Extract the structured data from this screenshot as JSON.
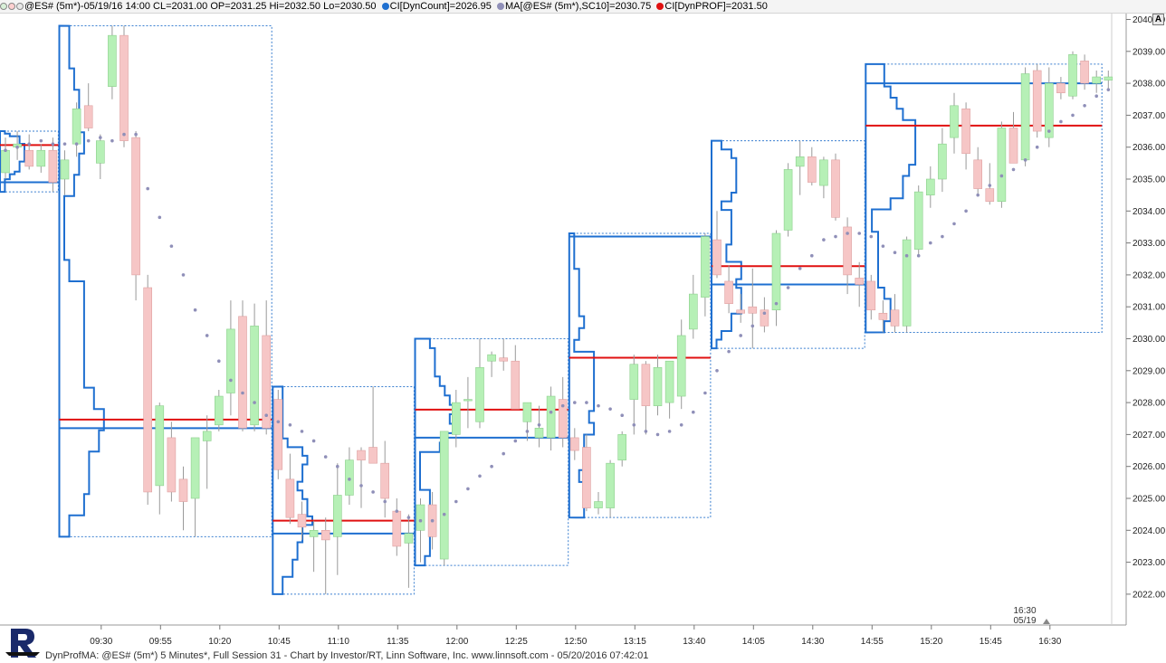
{
  "legend": {
    "symbol_info": "@ES# (5m*)-05/19/16 14:00 CL=2031.00 OP=2031.25 Hi=2032.50 Lo=2030.50",
    "dyncount": "CI[DynCount]=2026.95",
    "ma": "MA[@ES# (5m*),SC10]=2030.75",
    "dynprof": "CI[DynPROF]=2031.50",
    "colors": {
      "dyncount": "#1e6fd0",
      "ma": "#8f8fb8",
      "dynprof": "#e01010"
    }
  },
  "corner_button": "A",
  "footer": "DynProfMA: @ES# (5m*) 5 Minutes*, Full Session 31 - Chart by Investor/RT, Linn Software, Inc. www.linnsoft.com - 05/20/2016 07:42:01",
  "chart_data": {
    "type": "candlestick",
    "y_ticks": [
      2022,
      2023,
      2024,
      2025,
      2026,
      2027,
      2028,
      2029,
      2030,
      2031,
      2032,
      2033,
      2034,
      2035,
      2036,
      2037,
      2038,
      2039,
      2040
    ],
    "ylim": [
      2021.5,
      2040.3
    ],
    "time_ticks": [
      {
        "label": "09:30",
        "i": 8
      },
      {
        "label": "09:55",
        "i": 13
      },
      {
        "label": "10:20",
        "i": 18
      },
      {
        "label": "10:45",
        "i": 23
      },
      {
        "label": "11:10",
        "i": 28
      },
      {
        "label": "11:35",
        "i": 33
      },
      {
        "label": "12:00",
        "i": 38
      },
      {
        "label": "12:25",
        "i": 43
      },
      {
        "label": "12:50",
        "i": 48
      },
      {
        "label": "13:15",
        "i": 53
      },
      {
        "label": "13:40",
        "i": 58
      },
      {
        "label": "14:05",
        "i": 63
      },
      {
        "label": "14:30",
        "i": 68
      },
      {
        "label": "14:55",
        "i": 73
      },
      {
        "label": "15:20",
        "i": 78
      },
      {
        "label": "15:45",
        "i": 83
      },
      {
        "label": "16:30",
        "i": 88
      }
    ],
    "last_label": {
      "time": "16:30",
      "date": "05/19"
    },
    "candles": [
      {
        "o": 2035.2,
        "h": 2036.3,
        "l": 2035.0,
        "c": 2035.9
      },
      {
        "o": 2036.0,
        "h": 2036.5,
        "l": 2035.6,
        "c": 2036.1
      },
      {
        "o": 2035.9,
        "h": 2036.4,
        "l": 2035.3,
        "c": 2035.4
      },
      {
        "o": 2035.4,
        "h": 2036.1,
        "l": 2035.2,
        "c": 2035.9
      },
      {
        "o": 2035.9,
        "h": 2036.3,
        "l": 2034.6,
        "c": 2034.9
      },
      {
        "o": 2035.0,
        "h": 2035.9,
        "l": 2034.5,
        "c": 2035.6
      },
      {
        "o": 2036.1,
        "h": 2037.4,
        "l": 2035.7,
        "c": 2037.2
      },
      {
        "o": 2037.3,
        "h": 2038.0,
        "l": 2036.5,
        "c": 2036.6
      },
      {
        "o": 2035.5,
        "h": 2036.4,
        "l": 2035.0,
        "c": 2036.2
      },
      {
        "o": 2037.9,
        "h": 2039.8,
        "l": 2037.5,
        "c": 2039.5
      },
      {
        "o": 2039.5,
        "h": 2039.8,
        "l": 2036.0,
        "c": 2036.2
      },
      {
        "o": 2036.3,
        "h": 2036.5,
        "l": 2031.2,
        "c": 2032.0
      },
      {
        "o": 2031.6,
        "h": 2032.0,
        "l": 2024.8,
        "c": 2025.2
      },
      {
        "o": 2025.4,
        "h": 2028.0,
        "l": 2024.5,
        "c": 2027.9
      },
      {
        "o": 2026.9,
        "h": 2027.4,
        "l": 2024.9,
        "c": 2025.2
      },
      {
        "o": 2025.6,
        "h": 2026.0,
        "l": 2024.0,
        "c": 2024.9
      },
      {
        "o": 2025.0,
        "h": 2026.0,
        "l": 2023.8,
        "c": 2026.9
      },
      {
        "o": 2026.8,
        "h": 2027.6,
        "l": 2025.3,
        "c": 2027.1
      },
      {
        "o": 2027.3,
        "h": 2028.4,
        "l": 2027.1,
        "c": 2028.2
      },
      {
        "o": 2028.3,
        "h": 2031.2,
        "l": 2027.6,
        "c": 2030.3
      },
      {
        "o": 2030.7,
        "h": 2031.2,
        "l": 2027.1,
        "c": 2027.2
      },
      {
        "o": 2027.3,
        "h": 2031.1,
        "l": 2027.1,
        "c": 2030.4
      },
      {
        "o": 2030.1,
        "h": 2031.2,
        "l": 2027.0,
        "c": 2027.2
      },
      {
        "o": 2028.1,
        "h": 2028.4,
        "l": 2025.6,
        "c": 2025.9
      },
      {
        "o": 2025.6,
        "h": 2026.4,
        "l": 2024.2,
        "c": 2024.4
      },
      {
        "o": 2024.5,
        "h": 2024.9,
        "l": 2023.7,
        "c": 2024.1
      },
      {
        "o": 2023.8,
        "h": 2024.3,
        "l": 2022.7,
        "c": 2024.0
      },
      {
        "o": 2024.0,
        "h": 2024.4,
        "l": 2022.0,
        "c": 2023.7
      },
      {
        "o": 2023.8,
        "h": 2026.1,
        "l": 2022.6,
        "c": 2025.1
      },
      {
        "o": 2025.1,
        "h": 2026.6,
        "l": 2024.8,
        "c": 2026.2
      },
      {
        "o": 2026.5,
        "h": 2026.6,
        "l": 2024.7,
        "c": 2026.2
      },
      {
        "o": 2026.6,
        "h": 2028.5,
        "l": 2026.2,
        "c": 2026.1
      },
      {
        "o": 2026.1,
        "h": 2026.8,
        "l": 2024.4,
        "c": 2025.0
      },
      {
        "o": 2024.6,
        "h": 2025.0,
        "l": 2023.2,
        "c": 2023.5
      },
      {
        "o": 2023.6,
        "h": 2024.5,
        "l": 2022.2,
        "c": 2023.9
      },
      {
        "o": 2024.0,
        "h": 2025.0,
        "l": 2023.0,
        "c": 2024.8
      },
      {
        "o": 2024.8,
        "h": 2025.2,
        "l": 2023.4,
        "c": 2023.8
      },
      {
        "o": 2023.1,
        "h": 2027.1,
        "l": 2022.9,
        "c": 2027.1
      },
      {
        "o": 2027.0,
        "h": 2028.4,
        "l": 2026.6,
        "c": 2028.0
      },
      {
        "o": 2028.1,
        "h": 2028.8,
        "l": 2027.2,
        "c": 2028.1
      },
      {
        "o": 2027.4,
        "h": 2030.0,
        "l": 2027.2,
        "c": 2029.1
      },
      {
        "o": 2029.3,
        "h": 2029.6,
        "l": 2028.8,
        "c": 2029.5
      },
      {
        "o": 2029.4,
        "h": 2030.0,
        "l": 2029.0,
        "c": 2029.3
      },
      {
        "o": 2029.3,
        "h": 2029.8,
        "l": 2027.8,
        "c": 2027.8
      },
      {
        "o": 2027.4,
        "h": 2028.0,
        "l": 2026.8,
        "c": 2028.0
      },
      {
        "o": 2026.9,
        "h": 2027.9,
        "l": 2026.6,
        "c": 2027.2
      },
      {
        "o": 2026.9,
        "h": 2028.5,
        "l": 2026.5,
        "c": 2028.2
      },
      {
        "o": 2028.1,
        "h": 2028.8,
        "l": 2026.6,
        "c": 2026.9
      },
      {
        "o": 2026.9,
        "h": 2027.2,
        "l": 2026.2,
        "c": 2026.5
      },
      {
        "o": 2026.6,
        "h": 2027.0,
        "l": 2024.6,
        "c": 2024.7
      },
      {
        "o": 2024.7,
        "h": 2025.2,
        "l": 2024.5,
        "c": 2024.9
      },
      {
        "o": 2024.7,
        "h": 2026.2,
        "l": 2024.4,
        "c": 2026.1
      },
      {
        "o": 2026.2,
        "h": 2027.1,
        "l": 2026.0,
        "c": 2027.0
      },
      {
        "o": 2028.1,
        "h": 2029.5,
        "l": 2027.0,
        "c": 2029.2
      },
      {
        "o": 2029.2,
        "h": 2029.3,
        "l": 2027.0,
        "c": 2027.9
      },
      {
        "o": 2027.9,
        "h": 2029.5,
        "l": 2027.6,
        "c": 2029.1
      },
      {
        "o": 2028.0,
        "h": 2029.3,
        "l": 2027.5,
        "c": 2029.3
      },
      {
        "o": 2028.2,
        "h": 2030.6,
        "l": 2027.8,
        "c": 2030.1
      },
      {
        "o": 2030.3,
        "h": 2032.0,
        "l": 2030.0,
        "c": 2031.4
      },
      {
        "o": 2031.3,
        "h": 2033.3,
        "l": 2030.7,
        "c": 2033.2
      },
      {
        "o": 2033.1,
        "h": 2034.0,
        "l": 2031.9,
        "c": 2032.0
      },
      {
        "o": 2031.8,
        "h": 2032.3,
        "l": 2030.8,
        "c": 2031.1
      },
      {
        "o": 2030.9,
        "h": 2031.4,
        "l": 2030.5,
        "c": 2030.8
      },
      {
        "o": 2031.0,
        "h": 2032.2,
        "l": 2029.7,
        "c": 2030.8
      },
      {
        "o": 2030.9,
        "h": 2031.3,
        "l": 2030.2,
        "c": 2030.4
      },
      {
        "o": 2030.9,
        "h": 2033.4,
        "l": 2030.4,
        "c": 2033.3
      },
      {
        "o": 2033.4,
        "h": 2035.5,
        "l": 2033.2,
        "c": 2035.3
      },
      {
        "o": 2035.4,
        "h": 2036.2,
        "l": 2034.5,
        "c": 2035.7
      },
      {
        "o": 2035.7,
        "h": 2036.0,
        "l": 2034.8,
        "c": 2034.9
      },
      {
        "o": 2034.8,
        "h": 2035.7,
        "l": 2034.4,
        "c": 2035.6
      },
      {
        "o": 2035.6,
        "h": 2035.8,
        "l": 2033.7,
        "c": 2033.8
      },
      {
        "o": 2033.5,
        "h": 2033.8,
        "l": 2031.4,
        "c": 2032.0
      },
      {
        "o": 2031.9,
        "h": 2032.4,
        "l": 2031.0,
        "c": 2031.7
      },
      {
        "o": 2031.8,
        "h": 2032.0,
        "l": 2030.6,
        "c": 2030.9
      },
      {
        "o": 2030.8,
        "h": 2031.2,
        "l": 2030.2,
        "c": 2030.6
      },
      {
        "o": 2030.9,
        "h": 2031.4,
        "l": 2030.2,
        "c": 2030.4
      },
      {
        "o": 2030.4,
        "h": 2033.2,
        "l": 2030.2,
        "c": 2033.1
      },
      {
        "o": 2032.8,
        "h": 2034.8,
        "l": 2032.6,
        "c": 2034.6
      },
      {
        "o": 2034.5,
        "h": 2035.4,
        "l": 2034.1,
        "c": 2035.0
      },
      {
        "o": 2035.0,
        "h": 2036.6,
        "l": 2034.6,
        "c": 2036.1
      },
      {
        "o": 2036.3,
        "h": 2037.7,
        "l": 2035.8,
        "c": 2037.3
      },
      {
        "o": 2037.2,
        "h": 2037.4,
        "l": 2035.3,
        "c": 2035.8
      },
      {
        "o": 2035.6,
        "h": 2036.0,
        "l": 2034.5,
        "c": 2034.7
      },
      {
        "o": 2034.7,
        "h": 2035.5,
        "l": 2034.2,
        "c": 2034.3
      },
      {
        "o": 2034.3,
        "h": 2036.8,
        "l": 2034.1,
        "c": 2036.6
      },
      {
        "o": 2036.6,
        "h": 2037.1,
        "l": 2035.8,
        "c": 2035.5
      },
      {
        "o": 2035.6,
        "h": 2038.5,
        "l": 2035.4,
        "c": 2038.3
      },
      {
        "o": 2038.4,
        "h": 2038.6,
        "l": 2036.3,
        "c": 2036.5
      },
      {
        "o": 2036.3,
        "h": 2038.5,
        "l": 2036.0,
        "c": 2038.0
      },
      {
        "o": 2038.0,
        "h": 2038.2,
        "l": 2037.5,
        "c": 2037.7
      },
      {
        "o": 2037.6,
        "h": 2039.0,
        "l": 2037.5,
        "c": 2038.9
      },
      {
        "o": 2038.7,
        "h": 2038.9,
        "l": 2037.8,
        "c": 2038.0
      },
      {
        "o": 2038.0,
        "h": 2038.4,
        "l": 2037.7,
        "c": 2038.2
      },
      {
        "o": 2038.1,
        "h": 2038.4,
        "l": 2037.8,
        "c": 2038.2
      }
    ],
    "ma": [
      2035.9,
      2036.0,
      2036.1,
      2036.2,
      2036.1,
      2036.1,
      2036.1,
      2036.2,
      2036.3,
      2036.2,
      2036.4,
      2036.4,
      2034.7,
      2033.8,
      2032.9,
      2032.0,
      2030.9,
      2030.1,
      2029.3,
      2028.7,
      2028.3,
      2028.0,
      2027.6,
      2027.4,
      2027.3,
      2027.1,
      2026.8,
      2026.3,
      2026.0,
      2025.6,
      2025.4,
      2025.2,
      2024.9,
      2024.6,
      2024.4,
      2024.3,
      2024.3,
      2024.5,
      2024.9,
      2025.3,
      2025.7,
      2026.0,
      2026.4,
      2026.8,
      2027.1,
      2027.3,
      2027.7,
      2027.9,
      2028.0,
      2028.0,
      2027.9,
      2027.8,
      2027.6,
      2027.3,
      2027.1,
      2027.0,
      2027.1,
      2027.3,
      2027.7,
      2028.3,
      2029.0,
      2029.6,
      2030.1,
      2030.4,
      2030.8,
      2031.1,
      2031.6,
      2032.2,
      2032.6,
      2033.1,
      2033.2,
      2033.3,
      2033.3,
      2033.2,
      2032.9,
      2032.7,
      2032.6,
      2032.6,
      2033.0,
      2033.2,
      2033.6,
      2034.0,
      2034.5,
      2034.8,
      2035.1,
      2035.3,
      2035.6,
      2036.0,
      2036.5,
      2036.8,
      2037.0,
      2037.3,
      2037.6,
      2037.8
    ]
  }
}
